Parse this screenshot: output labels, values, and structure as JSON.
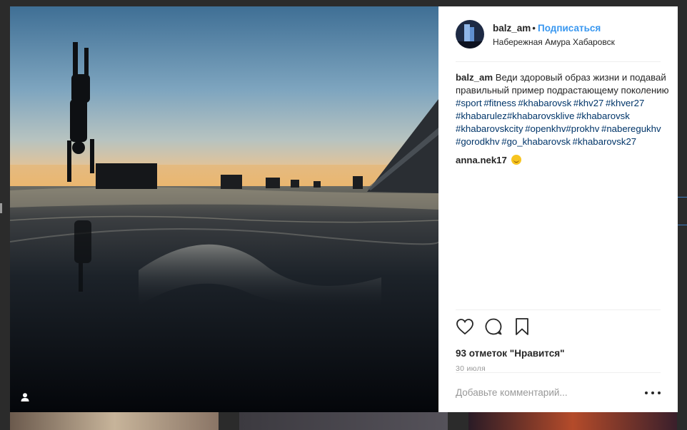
{
  "post": {
    "username": "balz_am",
    "separator": "•",
    "follow_label": "Подписаться",
    "location": "Набережная Амура Хабаровск"
  },
  "caption": {
    "username": "balz_am",
    "text": "Веди здоровый образ жизни и подавай правильный пример подрастающему поколению",
    "hashtags": "#sport #fitness #khabarovsk #khv27 #khver27 #khabarulez#khabarovsklive #khabarovsk #khabarovskcity #openkhv#prokhv #naberegukhv #gorodkhv #go_khabarovsk #khabarovsk27"
  },
  "comments": [
    {
      "username": "anna.nek17",
      "emoji": "smiling-face-emoji"
    }
  ],
  "actions": {
    "likes_text": "93 отметок \"Нравится\"",
    "date_text": "30 июля"
  },
  "add_comment": {
    "placeholder": "Добавьте комментарий..."
  },
  "icons": {
    "like": "heart-icon",
    "comment": "comment-bubble-icon",
    "save": "bookmark-icon",
    "more": "more-options-icon",
    "tagged_user": "user-tag-icon"
  },
  "colors": {
    "link_blue": "#3897f0",
    "hashtag_blue": "#003569",
    "text": "#262626",
    "muted": "#999999"
  }
}
